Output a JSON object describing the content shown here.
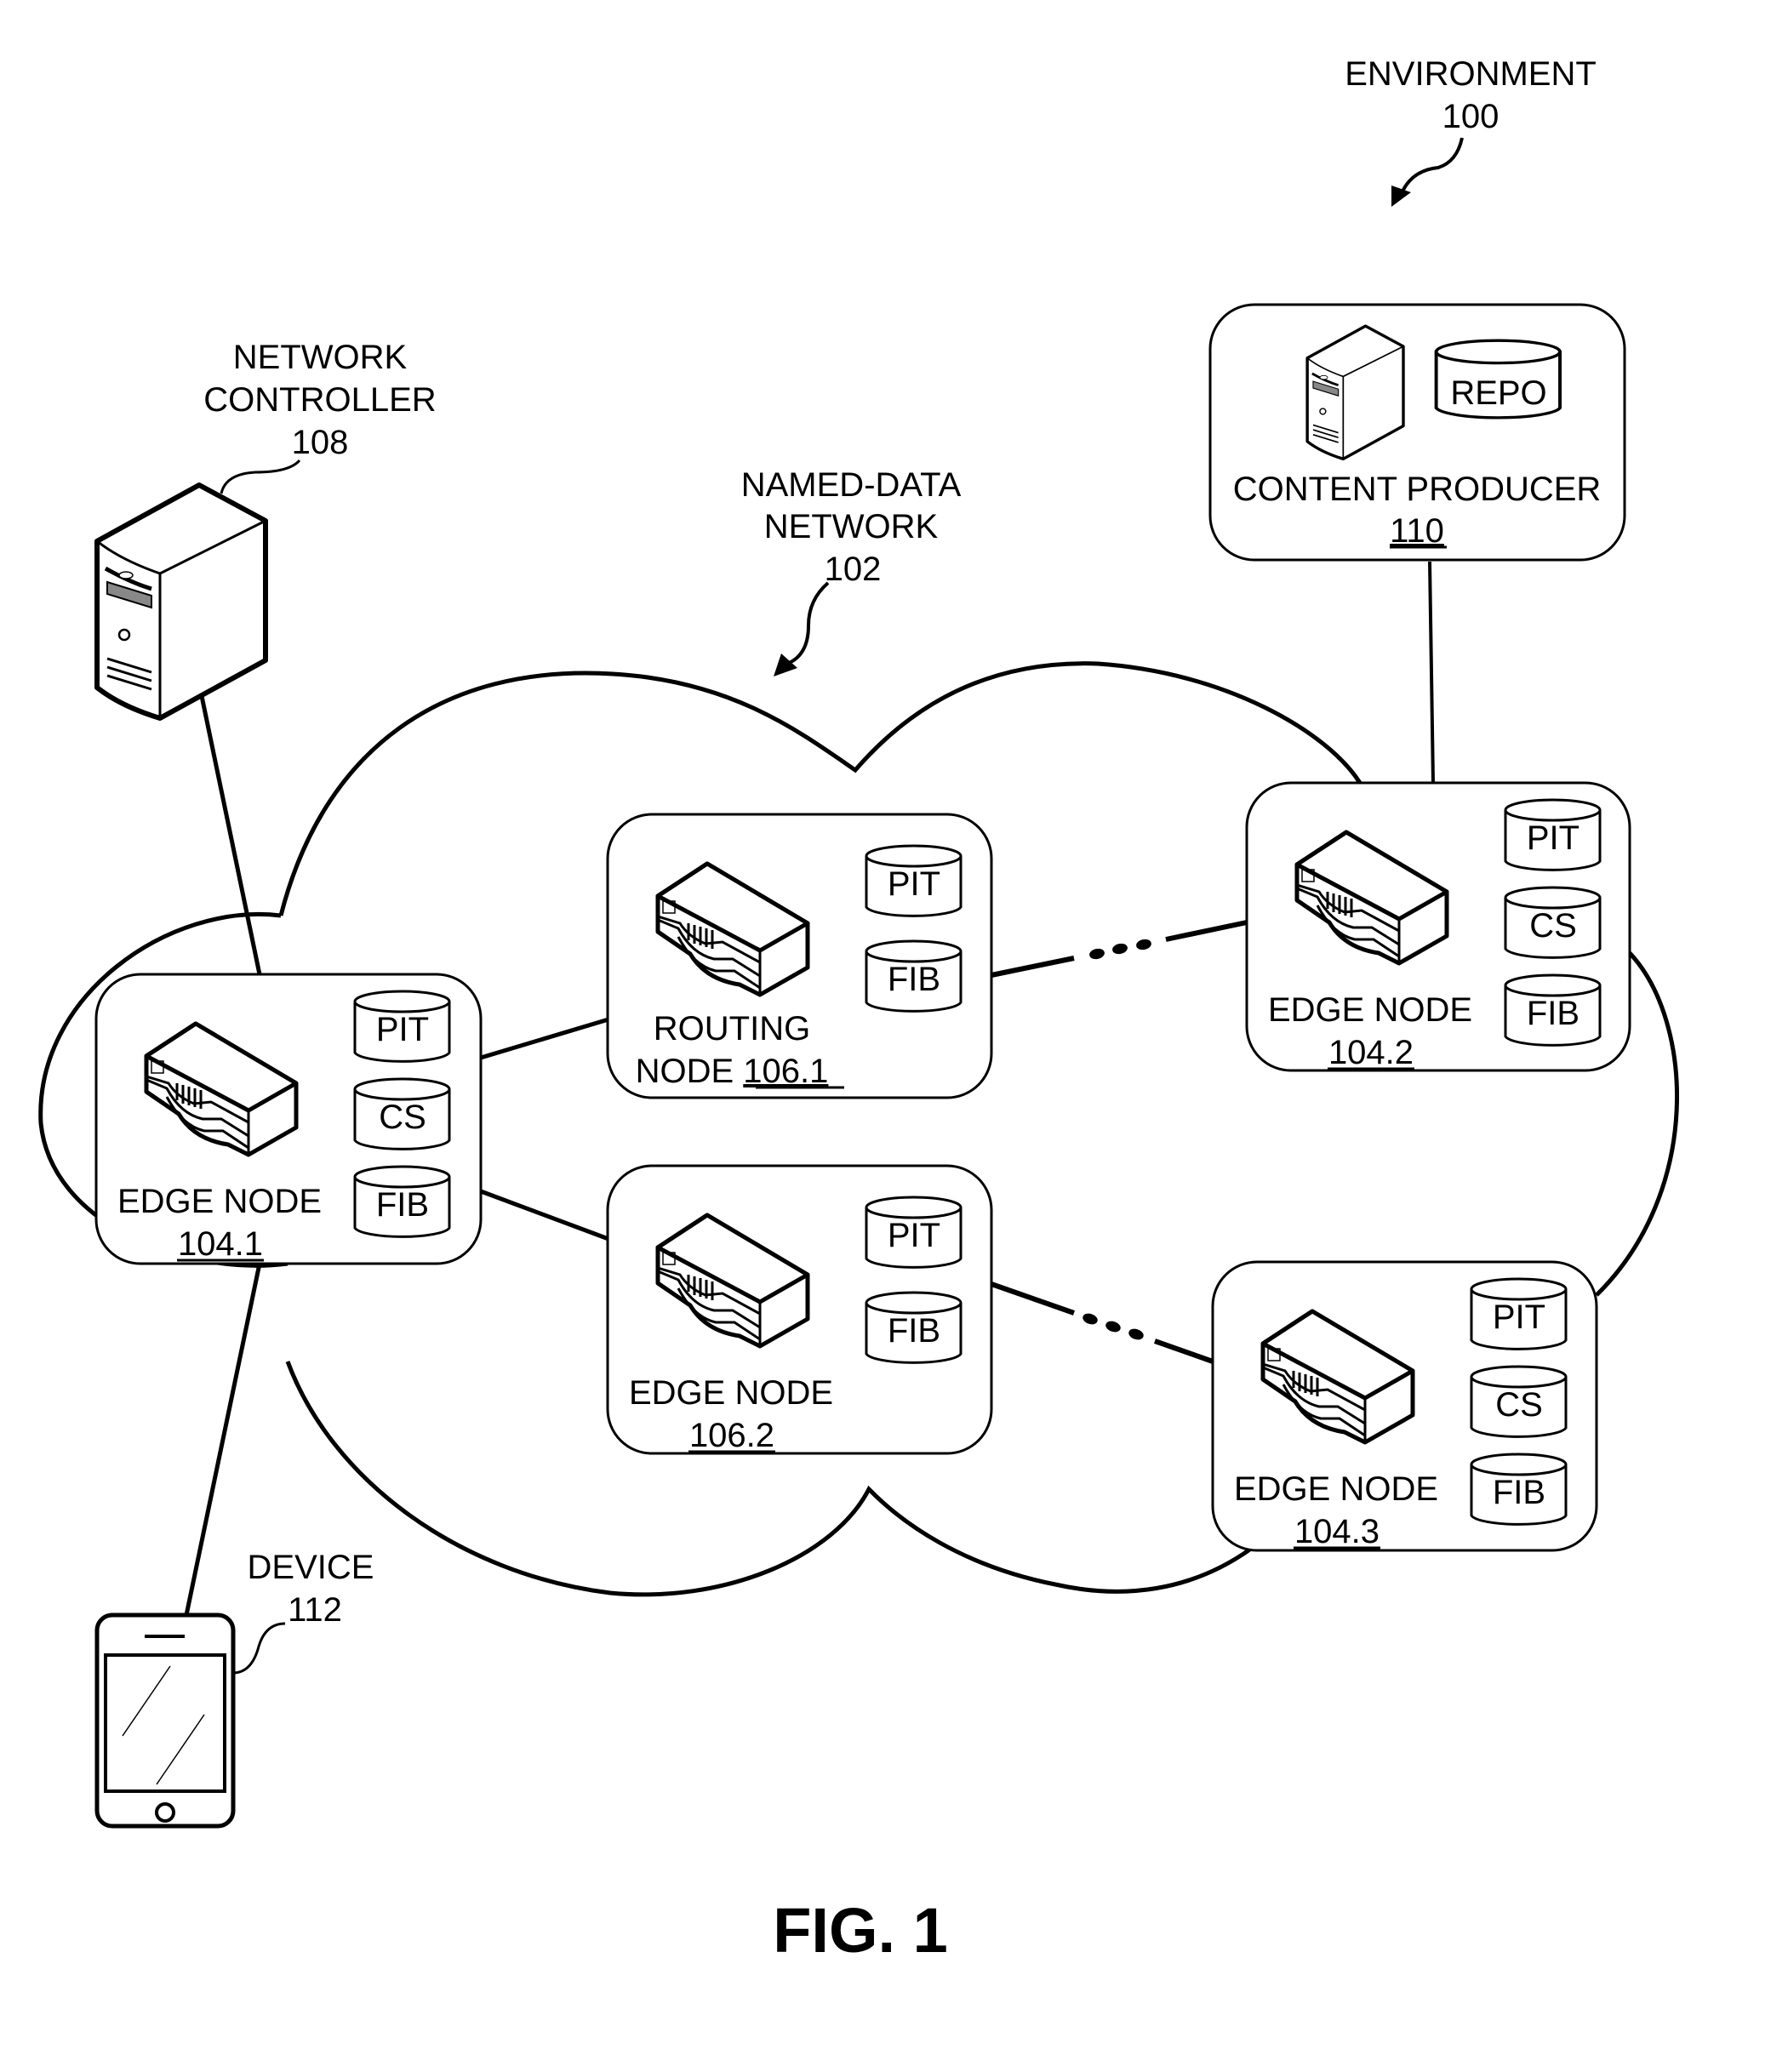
{
  "figure": {
    "caption": "FIG. 1",
    "environment": {
      "label": "ENVIRONMENT",
      "ref": "100"
    },
    "network": {
      "label_line1": "NAMED-DATA",
      "label_line2": "NETWORK",
      "ref": "102"
    },
    "controller": {
      "label_line1": "NETWORK",
      "label_line2": "CONTROLLER",
      "ref": "108",
      "icon": "server-tower-icon"
    },
    "device": {
      "label": "DEVICE",
      "ref": "112",
      "icon": "smartphone-icon"
    },
    "content_producer": {
      "label": "CONTENT PRODUCER",
      "ref": "110",
      "store": "REPO",
      "icon": "server-tower-icon"
    },
    "nodes": [
      {
        "id": "edge-104-1",
        "line1": "EDGE NODE",
        "ref": "104.1",
        "tables": [
          "PIT",
          "CS",
          "FIB"
        ]
      },
      {
        "id": "routing-106-1",
        "line1": "ROUTING",
        "line2_prefix": "NODE ",
        "ref": "106.1",
        "tables": [
          "PIT",
          "FIB"
        ]
      },
      {
        "id": "edge-106-2",
        "line1": "EDGE NODE",
        "ref": "106.2",
        "tables": [
          "PIT",
          "FIB"
        ]
      },
      {
        "id": "edge-104-2",
        "line1": "EDGE NODE",
        "ref": "104.2",
        "tables": [
          "PIT",
          "CS",
          "FIB"
        ]
      },
      {
        "id": "edge-104-3",
        "line1": "EDGE NODE",
        "ref": "104.3",
        "tables": [
          "PIT",
          "CS",
          "FIB"
        ]
      }
    ],
    "links": [
      {
        "from": "controller",
        "to": "edge-104-1",
        "style": "solid"
      },
      {
        "from": "device",
        "to": "edge-104-1",
        "style": "solid"
      },
      {
        "from": "edge-104-1",
        "to": "routing-106-1",
        "style": "solid"
      },
      {
        "from": "edge-104-1",
        "to": "edge-106-2",
        "style": "solid"
      },
      {
        "from": "routing-106-1",
        "to": "edge-104-2",
        "style": "dotted-gap"
      },
      {
        "from": "edge-106-2",
        "to": "edge-104-3",
        "style": "dotted-gap"
      },
      {
        "from": "content_producer",
        "to": "edge-104-2",
        "style": "solid"
      }
    ]
  }
}
